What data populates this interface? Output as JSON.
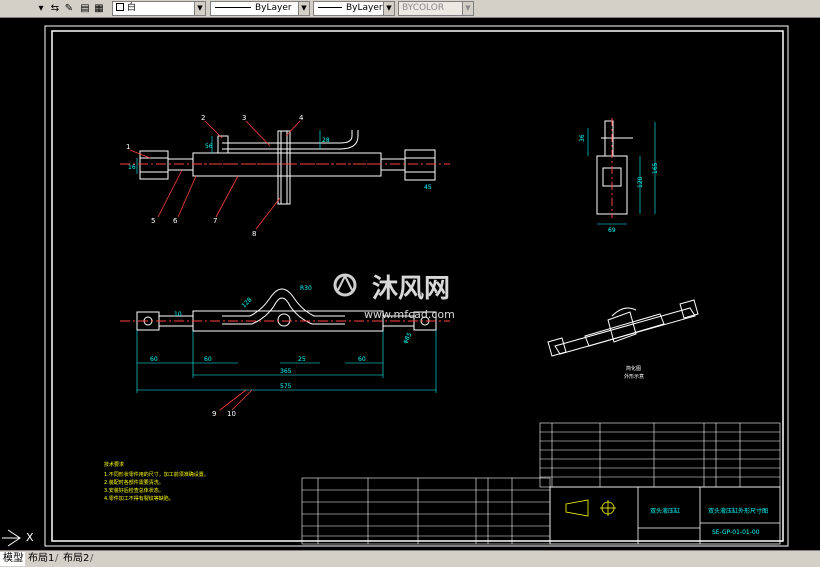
{
  "toolbar": {
    "color_value": "白",
    "linetype_value": "ByLayer",
    "lineweight_value": "ByLayer",
    "plotstyle_value": "BYCOLOR"
  },
  "drawing": {
    "leaders": [
      "1",
      "2",
      "3",
      "4",
      "5",
      "6",
      "7",
      "8",
      "9",
      "10"
    ],
    "dimensions": {
      "d575": "575",
      "d365": "365",
      "d60a": "60",
      "d60b": "60",
      "d60c": "60",
      "d25": "25",
      "d10": "10",
      "d16": "16",
      "d128": "128",
      "d28": "28",
      "d36": "36",
      "d120": "120",
      "d165": "165",
      "d69": "69",
      "d85": "φ85",
      "dR30": "R30",
      "d56": "56",
      "d45": "45"
    },
    "notes_title": "技术要求",
    "notes": [
      "1.不同形状零件用的尺寸，加工前须准确设置。",
      "2.装配时各部件需要清洗。",
      "3.安装好后检查总体状态。",
      "4.零件加工不得有裂纹等缺陷。"
    ],
    "title_block": {
      "name": "双头液压缸",
      "drawing_title": "双头液压缸外形尺寸图",
      "drawing_no": "SE-GP-01-01-00",
      "small_view_label": "简化图",
      "small_view_sub": "外形示意"
    },
    "watermark": {
      "cn": "沐风网",
      "url": "www.mfcad.com"
    }
  },
  "tabs": {
    "model": "模型",
    "layout1": "布局1",
    "layout2": "布局2"
  },
  "colors": {
    "frame": "#ffffff",
    "geometry": "#ffffff",
    "dimension": "#00ffff",
    "leader": "#ff4040",
    "notes": "#ffff00",
    "title_block": "#00ffff"
  }
}
